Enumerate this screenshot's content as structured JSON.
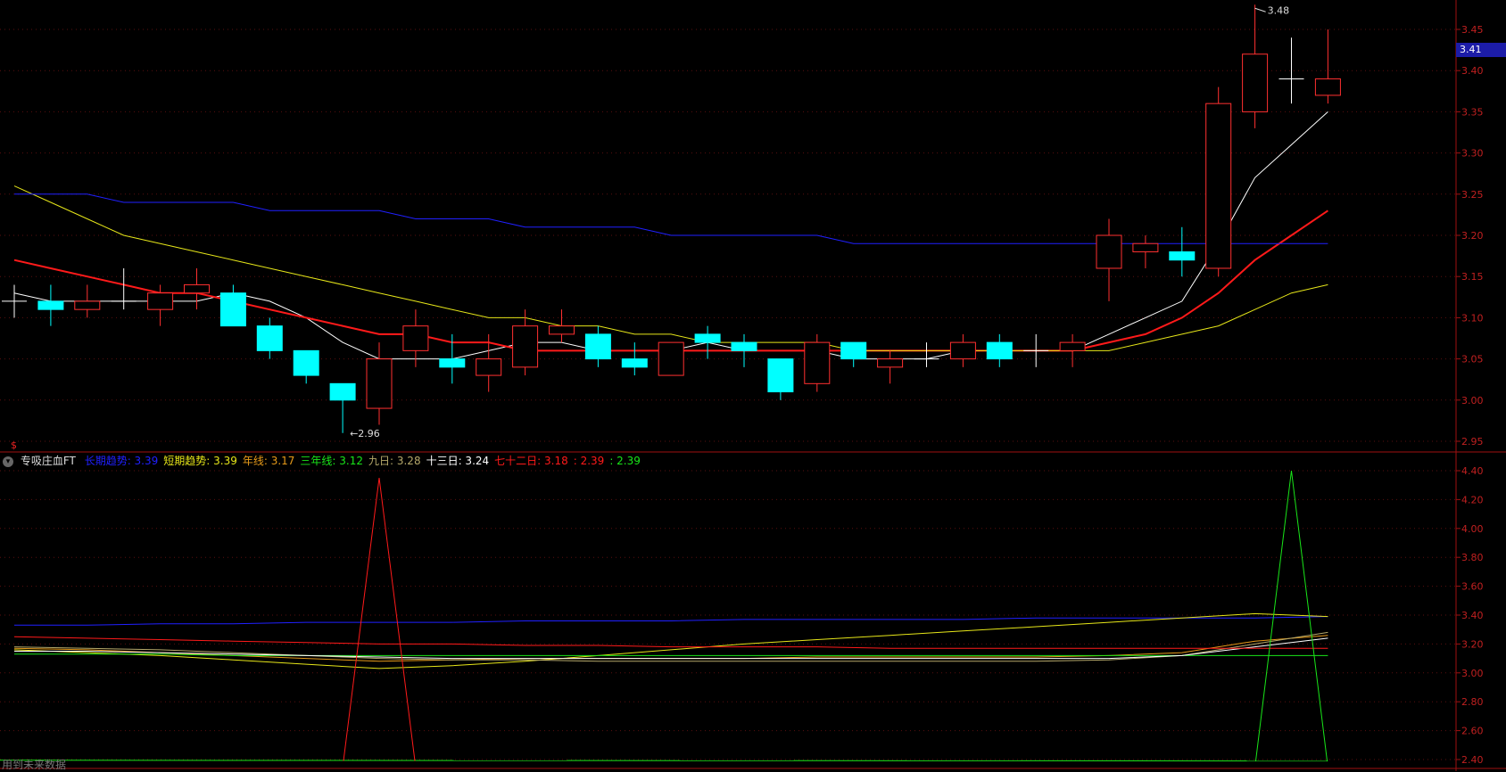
{
  "chart_data": [
    {
      "type": "candlestick",
      "panel": "main",
      "ylim": [
        2.93,
        3.48
      ],
      "yticks": [
        "3.45",
        "3.40",
        "3.35",
        "3.30",
        "3.25",
        "3.20",
        "3.15",
        "3.10",
        "3.05",
        "3.00",
        "2.95"
      ],
      "current_price": "3.41",
      "high_label": "3.48",
      "low_label": "2.96",
      "candles": [
        {
          "o": 3.12,
          "h": 3.14,
          "l": 3.1,
          "c": 3.12
        },
        {
          "o": 3.12,
          "h": 3.14,
          "l": 3.09,
          "c": 3.11
        },
        {
          "o": 3.11,
          "h": 3.14,
          "l": 3.1,
          "c": 3.12
        },
        {
          "o": 3.12,
          "h": 3.16,
          "l": 3.11,
          "c": 3.12
        },
        {
          "o": 3.11,
          "h": 3.14,
          "l": 3.09,
          "c": 3.13
        },
        {
          "o": 3.13,
          "h": 3.16,
          "l": 3.11,
          "c": 3.14
        },
        {
          "o": 3.13,
          "h": 3.14,
          "l": 3.09,
          "c": 3.09
        },
        {
          "o": 3.09,
          "h": 3.1,
          "l": 3.05,
          "c": 3.06
        },
        {
          "o": 3.06,
          "h": 3.06,
          "l": 3.02,
          "c": 3.03
        },
        {
          "o": 3.02,
          "h": 3.02,
          "l": 2.96,
          "c": 3.0
        },
        {
          "o": 2.99,
          "h": 3.07,
          "l": 2.97,
          "c": 3.05
        },
        {
          "o": 3.06,
          "h": 3.11,
          "l": 3.04,
          "c": 3.09
        },
        {
          "o": 3.05,
          "h": 3.08,
          "l": 3.02,
          "c": 3.04
        },
        {
          "o": 3.03,
          "h": 3.08,
          "l": 3.01,
          "c": 3.05
        },
        {
          "o": 3.04,
          "h": 3.11,
          "l": 3.03,
          "c": 3.09
        },
        {
          "o": 3.08,
          "h": 3.11,
          "l": 3.07,
          "c": 3.09
        },
        {
          "o": 3.08,
          "h": 3.09,
          "l": 3.04,
          "c": 3.05
        },
        {
          "o": 3.05,
          "h": 3.07,
          "l": 3.03,
          "c": 3.04
        },
        {
          "o": 3.03,
          "h": 3.07,
          "l": 3.03,
          "c": 3.07
        },
        {
          "o": 3.08,
          "h": 3.09,
          "l": 3.05,
          "c": 3.07
        },
        {
          "o": 3.07,
          "h": 3.08,
          "l": 3.04,
          "c": 3.06
        },
        {
          "o": 3.05,
          "h": 3.05,
          "l": 3.0,
          "c": 3.01
        },
        {
          "o": 3.02,
          "h": 3.08,
          "l": 3.01,
          "c": 3.07
        },
        {
          "o": 3.07,
          "h": 3.07,
          "l": 3.04,
          "c": 3.05
        },
        {
          "o": 3.04,
          "h": 3.06,
          "l": 3.02,
          "c": 3.05
        },
        {
          "o": 3.05,
          "h": 3.07,
          "l": 3.04,
          "c": 3.05
        },
        {
          "o": 3.05,
          "h": 3.08,
          "l": 3.04,
          "c": 3.07
        },
        {
          "o": 3.07,
          "h": 3.08,
          "l": 3.04,
          "c": 3.05
        },
        {
          "o": 3.06,
          "h": 3.08,
          "l": 3.04,
          "c": 3.06
        },
        {
          "o": 3.06,
          "h": 3.08,
          "l": 3.04,
          "c": 3.07
        },
        {
          "o": 3.16,
          "h": 3.22,
          "l": 3.12,
          "c": 3.2
        },
        {
          "o": 3.18,
          "h": 3.2,
          "l": 3.16,
          "c": 3.19
        },
        {
          "o": 3.18,
          "h": 3.21,
          "l": 3.15,
          "c": 3.17
        },
        {
          "o": 3.16,
          "h": 3.38,
          "l": 3.15,
          "c": 3.36
        },
        {
          "o": 3.35,
          "h": 3.48,
          "l": 3.33,
          "c": 3.42
        },
        {
          "o": 3.39,
          "h": 3.44,
          "l": 3.36,
          "c": 3.39
        },
        {
          "o": 3.37,
          "h": 3.45,
          "l": 3.36,
          "c": 3.39
        }
      ],
      "ma": [
        {
          "color": "#ffffff",
          "values": [
            3.13,
            3.12,
            3.12,
            3.12,
            3.12,
            3.12,
            3.13,
            3.12,
            3.1,
            3.07,
            3.05,
            3.05,
            3.05,
            3.06,
            3.07,
            3.07,
            3.06,
            3.06,
            3.06,
            3.07,
            3.06,
            3.06,
            3.06,
            3.05,
            3.05,
            3.05,
            3.06,
            3.06,
            3.06,
            3.06,
            3.08,
            3.1,
            3.12,
            3.19,
            3.27,
            3.31,
            3.35
          ]
        },
        {
          "color": "#ff1a1a",
          "values": [
            3.17,
            3.16,
            3.15,
            3.14,
            3.13,
            3.13,
            3.12,
            3.11,
            3.1,
            3.09,
            3.08,
            3.08,
            3.07,
            3.07,
            3.06,
            3.06,
            3.06,
            3.06,
            3.06,
            3.06,
            3.06,
            3.06,
            3.06,
            3.06,
            3.06,
            3.06,
            3.06,
            3.06,
            3.06,
            3.06,
            3.07,
            3.08,
            3.1,
            3.13,
            3.17,
            3.2,
            3.23
          ]
        },
        {
          "color": "#e6e619",
          "values": [
            3.26,
            3.24,
            3.22,
            3.2,
            3.19,
            3.18,
            3.17,
            3.16,
            3.15,
            3.14,
            3.13,
            3.12,
            3.11,
            3.1,
            3.1,
            3.09,
            3.09,
            3.08,
            3.08,
            3.07,
            3.07,
            3.07,
            3.07,
            3.06,
            3.06,
            3.06,
            3.06,
            3.06,
            3.06,
            3.06,
            3.06,
            3.07,
            3.08,
            3.09,
            3.11,
            3.13,
            3.14
          ]
        },
        {
          "color": "#2020ff",
          "values": [
            3.25,
            3.25,
            3.25,
            3.24,
            3.24,
            3.24,
            3.24,
            3.23,
            3.23,
            3.23,
            3.23,
            3.22,
            3.22,
            3.22,
            3.21,
            3.21,
            3.21,
            3.21,
            3.2,
            3.2,
            3.2,
            3.2,
            3.2,
            3.19,
            3.19,
            3.19,
            3.19,
            3.19,
            3.19,
            3.19,
            3.19,
            3.19,
            3.19,
            3.19,
            3.19,
            3.19,
            3.19
          ]
        }
      ]
    },
    {
      "type": "line",
      "panel": "indicator",
      "ylim": [
        2.3,
        4.5
      ],
      "yticks": [
        "4.40",
        "4.20",
        "4.00",
        "3.80",
        "3.60",
        "3.40",
        "3.20",
        "3.00",
        "2.80",
        "2.60",
        "2.40"
      ],
      "series": [
        {
          "color": "#2020ff",
          "values": [
            3.33,
            3.33,
            3.34,
            3.34,
            3.35,
            3.35,
            3.35,
            3.36,
            3.36,
            3.36,
            3.37,
            3.37,
            3.37,
            3.37,
            3.38,
            3.38,
            3.38,
            3.38,
            3.39
          ]
        },
        {
          "color": "#e6e619",
          "values": [
            3.16,
            3.14,
            3.12,
            3.09,
            3.06,
            3.03,
            3.05,
            3.08,
            3.12,
            3.16,
            3.2,
            3.23,
            3.26,
            3.29,
            3.32,
            3.35,
            3.38,
            3.41,
            3.39
          ]
        },
        {
          "color": "#e69a19",
          "values": [
            3.17,
            3.16,
            3.14,
            3.12,
            3.1,
            3.08,
            3.09,
            3.1,
            3.1,
            3.1,
            3.1,
            3.11,
            3.11,
            3.11,
            3.11,
            3.12,
            3.14,
            3.22,
            3.26
          ]
        },
        {
          "color": "#19e619",
          "values": [
            3.13,
            3.13,
            3.13,
            3.12,
            3.12,
            3.12,
            3.12,
            3.12,
            3.12,
            3.12,
            3.12,
            3.12,
            3.12,
            3.12,
            3.12,
            3.12,
            3.12,
            3.12,
            3.12
          ]
        },
        {
          "color": "#b5a86a",
          "values": [
            3.18,
            3.17,
            3.16,
            3.14,
            3.12,
            3.1,
            3.09,
            3.09,
            3.08,
            3.08,
            3.08,
            3.08,
            3.08,
            3.08,
            3.08,
            3.09,
            3.12,
            3.2,
            3.28
          ]
        },
        {
          "color": "#ffffff",
          "values": [
            3.15,
            3.15,
            3.14,
            3.13,
            3.12,
            3.11,
            3.1,
            3.1,
            3.1,
            3.1,
            3.1,
            3.1,
            3.1,
            3.1,
            3.1,
            3.1,
            3.12,
            3.18,
            3.24
          ]
        },
        {
          "color": "#ff1a1a",
          "values": [
            3.25,
            3.24,
            3.23,
            3.22,
            3.21,
            3.2,
            3.2,
            3.19,
            3.19,
            3.18,
            3.18,
            3.18,
            3.17,
            3.17,
            3.17,
            3.17,
            3.17,
            3.17,
            3.17
          ]
        }
      ],
      "spikes": [
        {
          "color": "#ff1a1a",
          "peak": 4.35,
          "index": 10
        },
        {
          "color": "#19e619",
          "peak": 4.4,
          "index": 35
        }
      ]
    }
  ],
  "legend": {
    "name": "专吸庄血FT",
    "items": [
      {
        "label": "长期趋势:",
        "value": "3.39",
        "color": "#2020ff"
      },
      {
        "label": "短期趋势:",
        "value": "3.39",
        "color": "#e6e619"
      },
      {
        "label": "年线:",
        "value": "3.17",
        "color": "#e69a19"
      },
      {
        "label": "三年线:",
        "value": "3.12",
        "color": "#19e619"
      },
      {
        "label": "九日:",
        "value": "3.28",
        "color": "#b5a86a"
      },
      {
        "label": "十三日:",
        "value": "3.24",
        "color": "#ffffff"
      },
      {
        "label": "七十二日:",
        "value": "3.18",
        "color": "#ff1a1a"
      },
      {
        "label": ":",
        "value": "2.39",
        "color": "#ff1a1a"
      },
      {
        "label": ":",
        "value": "2.39",
        "color": "#19e619"
      }
    ]
  },
  "footnote": "用到未来数据",
  "dollar_mark": "$"
}
